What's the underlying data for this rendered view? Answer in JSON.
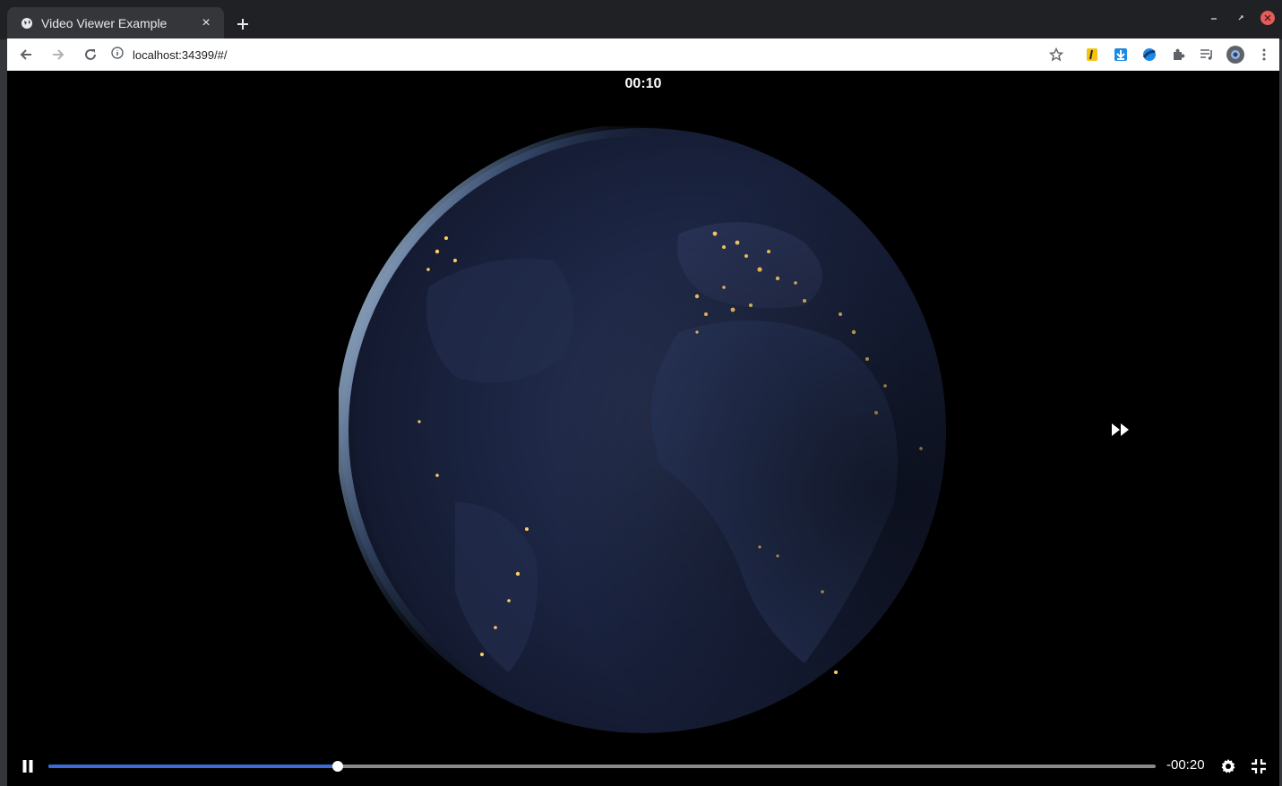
{
  "browser": {
    "tab": {
      "title": "Video Viewer Example",
      "favicon": "globe-icon",
      "close": "×"
    },
    "new_tab_label": "+",
    "address": "localhost:34399/#/",
    "window_controls": [
      "minimize-icon",
      "restore-icon",
      "close-icon"
    ]
  },
  "toolbar": {
    "nav": [
      "back-icon",
      "forward-icon",
      "reload-icon"
    ],
    "extensions": [
      "bookmark-star-icon",
      "extension-yellow-icon",
      "download-icon",
      "extension-blue-icon",
      "puzzle-icon",
      "media-queue-icon",
      "profile-avatar",
      "menu-kebab-icon"
    ]
  },
  "video": {
    "current_time": "00:10",
    "remaining_time": "-00:20",
    "progress": 0.261,
    "state": "playing",
    "content": "earth-at-night"
  },
  "colors": {
    "progress_fill": "#3a6bd6",
    "progress_track": "#8a8a8a",
    "background": "#000000"
  }
}
